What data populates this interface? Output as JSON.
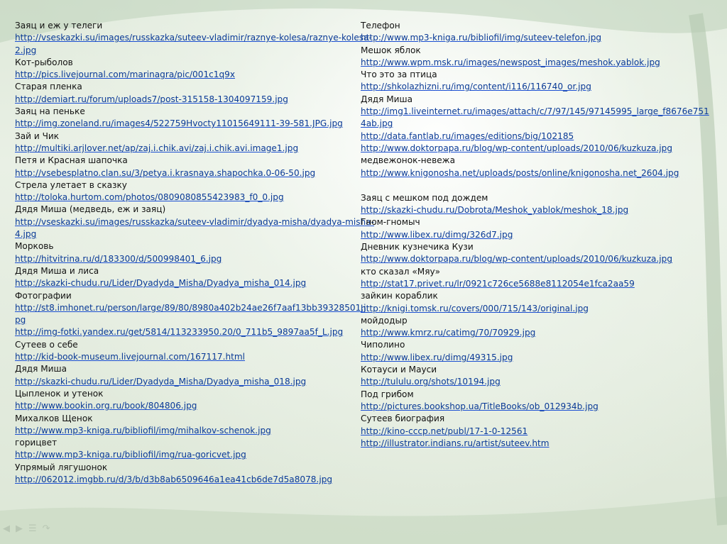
{
  "left_column": [
    {
      "t": "Заяц и еж у телеги",
      "link": false
    },
    {
      "t": "http://vseskazki.su/images/russkazka/suteev-vladimir/raznye-kolesa/raznye-kolesa-",
      "link": true
    },
    {
      "t": "2.jpg",
      "link": true
    },
    {
      "t": "Кот-рыболов",
      "link": false
    },
    {
      "t": "http://pics.livejournal.com/marinagra/pic/001c1q9x",
      "link": true
    },
    {
      "t": "Старая пленка",
      "link": false
    },
    {
      "t": "http://demiart.ru/forum/uploads7/post-315158-1304097159.jpg",
      "link": true
    },
    {
      "t": "Заяц на пеньке",
      "link": false
    },
    {
      "t": "http://img.zoneland.ru/images4/522759Hvocty11015649111-39-581.JPG.jpg",
      "link": true
    },
    {
      "t": "Зай и Чик",
      "link": false
    },
    {
      "t": "http://multiki.arjlover.net/ap/zaj.i.chik.avi/zaj.i.chik.avi.image1.jpg",
      "link": true
    },
    {
      "t": "Петя и Красная шапочка",
      "link": false
    },
    {
      "t": "http://vsebesplatno.clan.su/3/petya.i.krasnaya.shapochka.0-06-50.jpg",
      "link": true
    },
    {
      "t": "Стрела улетает в сказку",
      "link": false
    },
    {
      "t": "http://toloka.hurtom.com/photos/0809080855423983_f0_0.jpg",
      "link": true
    },
    {
      "t": "Дядя Миша (медведь, еж и заяц)",
      "link": false
    },
    {
      "t": "http://vseskazki.su/images/russkazka/suteev-vladimir/dyadya-misha/dyadya-misha-",
      "link": true
    },
    {
      "t": "4.jpg",
      "link": true
    },
    {
      "t": "Морковь",
      "link": false
    },
    {
      "t": "http://hitvitrina.ru/d/183300/d/500998401_6.jpg",
      "link": true
    },
    {
      "t": "Дядя Миша и лиса",
      "link": false
    },
    {
      "t": "http://skazki-chudu.ru/Lider/Dyadyda_Misha/Dyadya_misha_014.jpg",
      "link": true
    },
    {
      "t": "Фотографии",
      "link": false
    },
    {
      "t": "http://st8.imhonet.ru/person/large/89/80/8980a402b24ae26f7aaf13bb39328501.j",
      "link": true
    },
    {
      "t": "pg",
      "link": true
    },
    {
      "t": "http://img-fotki.yandex.ru/get/5814/113233950.20/0_711b5_9897aa5f_L.jpg",
      "link": true
    },
    {
      "t": "Сутеев о себе",
      "link": false
    },
    {
      "t": "http://kid-book-museum.livejournal.com/167117.html",
      "link": true
    },
    {
      "t": "Дядя Миша",
      "link": false
    },
    {
      "t": "http://skazki-chudu.ru/Lider/Dyadyda_Misha/Dyadya_misha_018.jpg",
      "link": true
    },
    {
      "t": "Цыпленок и утенок",
      "link": false
    },
    {
      "t": "http://www.bookin.org.ru/book/804806.jpg",
      "link": true
    },
    {
      "t": "Михалков Щенок",
      "link": false
    },
    {
      "t": "http://www.mp3-kniga.ru/bibliofil/img/mihalkov-schenok.jpg",
      "link": true
    },
    {
      "t": "горицвет",
      "link": false
    },
    {
      "t": "http://www.mp3-kniga.ru/bibliofil/img/rua-goricvet.jpg",
      "link": true
    },
    {
      "t": "Упрямый лягушонок",
      "link": false
    },
    {
      "t": "http://062012.imgbb.ru/d/3/b/d3b8ab6509646a1ea41cb6de7d5a8078.jpg",
      "link": true
    }
  ],
  "right_column": [
    {
      "t": "Телефон",
      "link": false
    },
    {
      "t": "http://www.mp3-kniga.ru/bibliofil/img/suteev-telefon.jpg",
      "link": true
    },
    {
      "t": "Мешок яблок",
      "link": false
    },
    {
      "t": "http://www.wpm.msk.ru/images/newspost_images/meshok.yablok.jpg",
      "link": true
    },
    {
      "t": "Что это за птица",
      "link": false
    },
    {
      "t": "http://shkolazhizni.ru/img/content/i116/116740_or.jpg",
      "link": true
    },
    {
      "t": "Дядя Миша",
      "link": false
    },
    {
      "t": "http://img1.liveinternet.ru/images/attach/c/7/97/145/97145995_large_f8676e751",
      "link": true
    },
    {
      "t": "4ab.jpg",
      "link": true
    },
    {
      "t": "http://data.fantlab.ru/images/editions/big/102185",
      "link": true
    },
    {
      "t": "http://www.doktorpapa.ru/blog/wp-content/uploads/2010/06/kuzkuza.jpg",
      "link": true
    },
    {
      "t": "медвежонок-невежа",
      "link": false
    },
    {
      "t": "http://www.knigonosha.net/uploads/posts/online/knigonosha.net_2604.jpg",
      "link": true
    },
    {
      "t": "",
      "link": false
    },
    {
      "t": "Заяц с мешком под дождем",
      "link": false
    },
    {
      "t": "http://skazki-chudu.ru/Dobrota/Meshok_yablok/meshok_18.jpg",
      "link": true
    },
    {
      "t": "Гном-гномыч",
      "link": false
    },
    {
      "t": "http://www.libex.ru/dimg/326d7.jpg",
      "link": true
    },
    {
      "t": "Дневник кузнечика Кузи",
      "link": false
    },
    {
      "t": "http://www.doktorpapa.ru/blog/wp-content/uploads/2010/06/kuzkuza.jpg",
      "link": true
    },
    {
      "t": "кто сказал «Мяу»",
      "link": false
    },
    {
      "t": "http://stat17.privet.ru/lr/0921c726ce5688e8112054e1fca2aa59",
      "link": true
    },
    {
      "t": "зайкин кораблик",
      "link": false
    },
    {
      "t": "http://knigi.tomsk.ru/covers/000/715/143/original.jpg",
      "link": true
    },
    {
      "t": "мойдодыр",
      "link": false
    },
    {
      "t": "http://www.kmrz.ru/catimg/70/70929.jpg",
      "link": true
    },
    {
      "t": "Чиполино",
      "link": false
    },
    {
      "t": "http://www.libex.ru/dimg/49315.jpg",
      "link": true
    },
    {
      "t": "Котауси и Мауси",
      "link": false
    },
    {
      "t": "http://tululu.org/shots/10194.jpg",
      "link": true
    },
    {
      "t": "Под грибом",
      "link": false
    },
    {
      "t": "http://pictures.bookshop.ua/TitleBooks/ob_012934b.jpg",
      "link": true
    },
    {
      "t": "Сутеев биография",
      "link": false
    },
    {
      "t": "http://kino-cccp.net/publ/17-1-0-12561",
      "link": true
    },
    {
      "t": "http://illustrator.indians.ru/artist/suteev.htm",
      "link": true
    }
  ],
  "nav_icons": [
    "arrow-left-icon",
    "arrow-right-icon",
    "menu-icon",
    "redo-icon"
  ],
  "colors": {
    "link": "#0a3a96",
    "text": "#111111",
    "background": "#dfe9da"
  }
}
